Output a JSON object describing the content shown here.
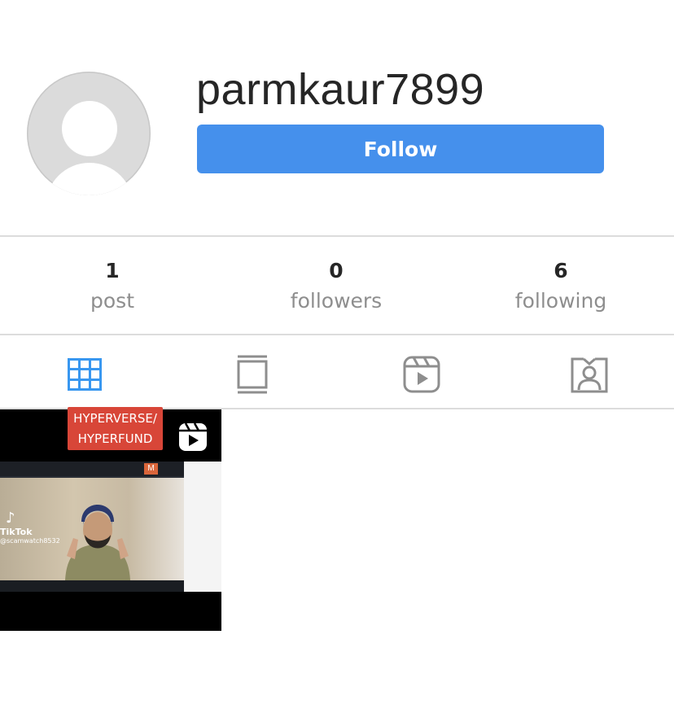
{
  "profile": {
    "username": "parmkaur7899",
    "follow_label": "Follow"
  },
  "stats": {
    "posts": {
      "value": "1",
      "label": "post"
    },
    "followers": {
      "value": "0",
      "label": "followers"
    },
    "following": {
      "value": "6",
      "label": "following"
    }
  },
  "tabs": [
    {
      "icon": "grid-icon",
      "active": true
    },
    {
      "icon": "feed-icon",
      "active": false
    },
    {
      "icon": "reels-icon",
      "active": false
    },
    {
      "icon": "tagged-icon",
      "active": false
    }
  ],
  "colors": {
    "follow_button": "#4590ec",
    "active_tab": "#3897f0",
    "inactive_tab": "#8e8e8e"
  },
  "posts": [
    {
      "caption_line1": "HYPERVERSE/",
      "caption_line2": "HYPERFUND",
      "tiktok_label": "TikTok",
      "tiktok_handle": "@scamwatch8532",
      "meeting_badge": "M",
      "type": "reel"
    }
  ]
}
